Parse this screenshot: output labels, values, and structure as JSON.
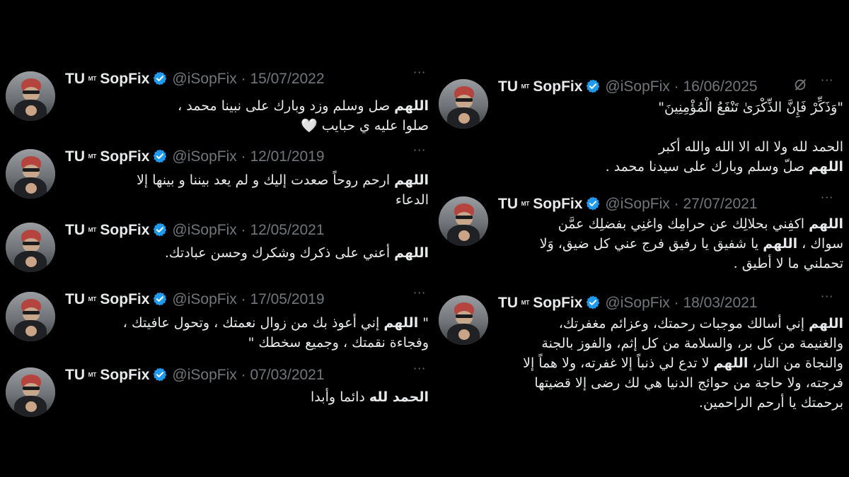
{
  "account": {
    "name": "TU",
    "name_mark": "ᴹᵀ",
    "name_tail": "SopFix",
    "handle": "@iSopFix",
    "more_glyph": "···",
    "verified_color": "#1d9bf0"
  },
  "left_column": [
    {
      "date": "15/07/2022",
      "lines": [
        [
          {
            "t": "اللهم",
            "b": true
          },
          {
            "t": " صل وسلم وزد وبارك على نبينا محمد ،"
          }
        ],
        [
          {
            "t": "صلوا عليه ي حبايب 🤍"
          }
        ]
      ]
    },
    {
      "date": "12/01/2019",
      "lines": [
        [
          {
            "t": "اللهم",
            "b": true
          },
          {
            "t": " ارحم روحاً صعدت إليك و لم يعد بيننا و بينها إلا"
          }
        ],
        [
          {
            "t": "الدعاء"
          }
        ]
      ]
    },
    {
      "date": "12/05/2021",
      "lines": [
        [
          {
            "t": "اللهم",
            "b": true
          },
          {
            "t": " أعني على ذكرك وشكرك وحسن عبادتك."
          }
        ]
      ]
    },
    {
      "date": "17/05/2019",
      "lines": [
        [
          {
            "t": "\" "
          },
          {
            "t": "اللهم",
            "b": true
          },
          {
            "t": " إني أعوذ بك من زوال نعمتك ، وتحول عافيتك ،"
          }
        ],
        [
          {
            "t": "وفجاءة نقمتك ، وجميع سخطك \""
          }
        ]
      ]
    },
    {
      "date": "07/03/2021",
      "lines": [
        [
          {
            "t": "الحمد لله",
            "b": true
          },
          {
            "t": " دائما وأبدا"
          }
        ]
      ]
    }
  ],
  "right_column": [
    {
      "date": "16/06/2025",
      "grok": true,
      "lines": [
        [
          {
            "t": "\"وَذَكِّرْ فَإِنَّ الذِّكْرَىٰ تَنْفَعُ الْمُؤْمِنِينَ\""
          }
        ],
        [
          {
            "t": " "
          }
        ],
        [
          {
            "t": "الحمد لله ولا اله الا الله والله أكبر"
          }
        ],
        [
          {
            "t": "اللهم",
            "b": true
          },
          {
            "t": " صلّ وسلم وبارك على سيدنا محمد ."
          }
        ]
      ]
    },
    {
      "date": "27/07/2021",
      "lines": [
        [
          {
            "t": "اللهم",
            "b": true
          },
          {
            "t": " اكفِني بحلالِك عن حرامِك واغنِي بفضلِك عمَّن"
          }
        ],
        [
          {
            "t": "سواك ، "
          },
          {
            "t": "اللهم",
            "b": true
          },
          {
            "t": " يا شفيق يا رفيق فرج عني كل ضيق، وَلا"
          }
        ],
        [
          {
            "t": "تحملني ما لا أطيق ."
          }
        ]
      ]
    },
    {
      "date": "18/03/2021",
      "lines": [
        [
          {
            "t": "اللهم",
            "b": true
          },
          {
            "t": " إني أسالك موجبات رحمتك، وعزائم مغفرتك،"
          }
        ],
        [
          {
            "t": "والغنيمة من كل بر، والسلامة من كل إثم، والفوز بالجنة"
          }
        ],
        [
          {
            "t": "والنجاة من النار، "
          },
          {
            "t": "اللهم",
            "b": true
          },
          {
            "t": " لا تدع لي ذنباً إلا غفرته، ولا هماً إلا"
          }
        ],
        [
          {
            "t": "فرجته، ولا حاجة من حوائج الدنيا هي لك رضى إلا قضيتها"
          }
        ],
        [
          {
            "t": "برحمتك يا أرحم الراحمين."
          }
        ]
      ]
    }
  ]
}
